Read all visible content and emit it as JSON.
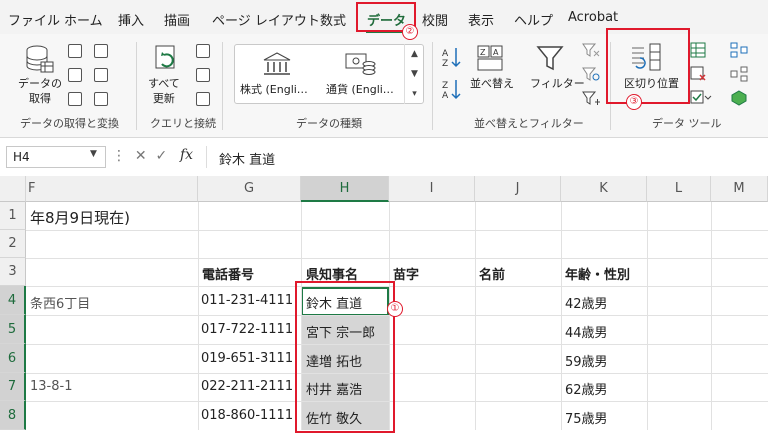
{
  "tabs": [
    "ファイル",
    "ホーム",
    "挿入",
    "描画",
    "ページ レイアウト",
    "数式",
    "データ",
    "校閲",
    "表示",
    "ヘルプ",
    "Acrobat"
  ],
  "ribbon": {
    "get_data": "データの\n取得",
    "refresh_all": "すべて\n更新",
    "stocks": "株式 (Engli…",
    "currency": "通貨 (Engli…",
    "sort": "並べ替え",
    "filter": "フィルター",
    "text_to_columns": "区切り位置",
    "groups": {
      "get_transform": "データの取得と変換",
      "queries": "クエリと接続",
      "data_types": "データの種類",
      "sort_filter": "並べ替えとフィルター",
      "data_tools": "データ ツール"
    }
  },
  "annotations": [
    "①",
    "②",
    "③"
  ],
  "formula_bar": {
    "name_box": "H4",
    "fx": "fx",
    "formula": "鈴木 直道"
  },
  "columns": [
    "F",
    "G",
    "H",
    "I",
    "J",
    "K",
    "L",
    "M"
  ],
  "rows": [
    "1",
    "2",
    "3",
    "4",
    "5",
    "6",
    "7",
    "8"
  ],
  "cells": {
    "r1_F": "年8月9日現在)",
    "r3_G": "電話番号",
    "r3_H": "県知事名",
    "r3_I": "苗字",
    "r3_J": "名前",
    "r3_K": "年齢・性別",
    "r4_F": "条西6丁目",
    "r4_G": "011-231-4111",
    "r4_H": "鈴木 直道",
    "r4_K": "42歳男",
    "r5_G": "017-722-1111",
    "r5_H": "宮下 宗一郎",
    "r5_K": "44歳男",
    "r6_G": "019-651-3111",
    "r6_H": "達増 拓也",
    "r6_K": "59歳男",
    "r7_F": "13-8-1",
    "r7_G": "022-211-2111",
    "r7_H": "村井 嘉浩",
    "r7_K": "62歳男",
    "r8_G": "018-860-1111",
    "r8_H": "佐竹 敬久",
    "r8_K": "75歳男"
  },
  "colors": {
    "accent_green": "#1e7a45",
    "annotation_red": "#e0192c"
  }
}
